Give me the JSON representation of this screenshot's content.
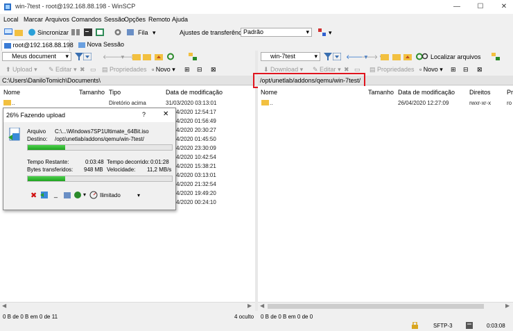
{
  "window": {
    "title": "win-7test - root@192.168.88.198 - WinSCP",
    "min": "—",
    "max": "☐",
    "close": "✕"
  },
  "menu": [
    "Local",
    "Marcar",
    "Arquivos",
    "Comandos",
    "Sessão",
    "Opções",
    "Remoto",
    "Ajuda"
  ],
  "toolbar": {
    "sync": "Sincronizar",
    "queue": "Fila",
    "transfer_label": "Ajustes de transferência",
    "transfer_value": "Padrão"
  },
  "tabs": {
    "session": "root@192.168.88.198",
    "new_session": "Nova Sessão"
  },
  "left": {
    "location": "Meus document",
    "upload": "Upload",
    "edit": "Editar",
    "props": "Propriedades",
    "new": "Novo",
    "path": "C:\\Users\\DaniloTomich\\Documents\\",
    "columns": [
      "Nome",
      "Tamanho",
      "Tipo",
      "Data de modificação"
    ],
    "rows": [
      {
        "name": "..",
        "size": "",
        "type": "Diretório acima",
        "date": "31/03/2020  03:13:01"
      },
      {
        "date": "4/2020  12:54:17"
      },
      {
        "date": "4/2020  01:56:49"
      },
      {
        "date": "4/2020  20:30:27"
      },
      {
        "date": "4/2020  01:45:50"
      },
      {
        "date": "4/2020  23:30:09"
      },
      {
        "date": "4/2020  10:42:54"
      },
      {
        "date": "4/2020  15:38:21"
      },
      {
        "date": "4/2020  03:13:01"
      },
      {
        "date": "4/2020  21:32:54"
      },
      {
        "date": "4/2020  19:49:20"
      },
      {
        "date": "4/2020  00:24:10"
      }
    ],
    "status": "0 B de 0 B em 0 de 11",
    "hidden": "4 oculto"
  },
  "right": {
    "location": "win-7test",
    "find": "Localizar arquivos",
    "download": "Download",
    "edit": "Editar",
    "props": "Propriedades",
    "new": "Novo",
    "path": "/opt/unetlab/addons/qemu/win-7test/",
    "columns": [
      "Nome",
      "Tamanho",
      "Data de modificação",
      "Direitos",
      "Pr"
    ],
    "rows": [
      {
        "name": "..",
        "date": "26/04/2020 12:27:09",
        "rights": "rwxr-xr-x",
        "owner": "ro"
      }
    ],
    "status": "0 B de 0 B em 0 de 0",
    "sftp": "SFTP-3",
    "time": "0:03:08"
  },
  "dialog": {
    "title": "26% Fazendo upload",
    "help": "?",
    "close": "✕",
    "file_label": "Arquivo",
    "file_value": "C:\\...\\Windows7SP1Ultimate_64Bit.iso",
    "dest_label": "Destino:",
    "dest_value": "/opt/unetlab/addons/qemu/win-7test/",
    "file_progress": 0.26,
    "remaining_label": "Tempo Restante:",
    "remaining_value": "0:03:48",
    "elapsed_label": "Tempo decorrido:",
    "elapsed_value": "0:01:28",
    "bytes_label": "Bytes transferidos:",
    "bytes_value": "948 MB",
    "speed_label": "Velocidade:",
    "speed_value": "11,2 MB/s",
    "total_progress": 0.26,
    "speed_limit": "Ilimitado"
  }
}
